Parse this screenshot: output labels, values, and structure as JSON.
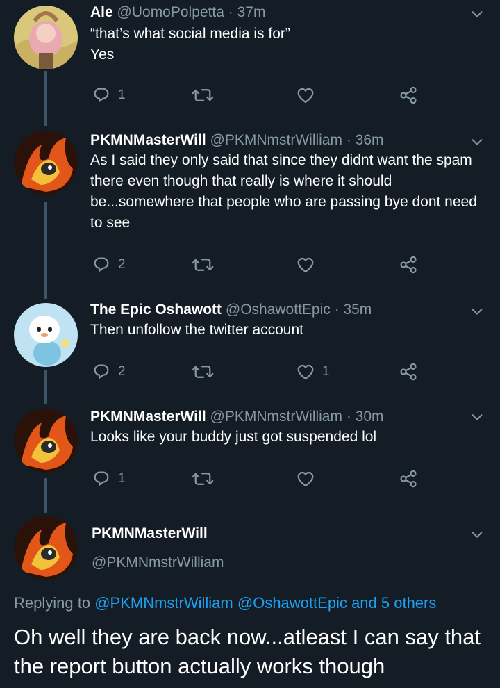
{
  "tweets": [
    {
      "name": "Ale",
      "handle": "@UomoPolpetta",
      "time": "37m",
      "lines": [
        "“that’s what social media is for”",
        "Yes"
      ],
      "reply_count": "1",
      "retweet_count": "",
      "like_count": ""
    },
    {
      "name": "PKMNMasterWill",
      "handle": "@PKMNmstrWilliam",
      "time": "36m",
      "text": "As I said they only said that since they didnt want the spam there even though that really is where it should be...somewhere that people who are passing bye dont need to see",
      "reply_count": "2",
      "retweet_count": "",
      "like_count": ""
    },
    {
      "name": "The Epic Oshawott",
      "handle": "@OshawottEpic",
      "time": "35m",
      "text": "Then unfollow the twitter account",
      "reply_count": "2",
      "retweet_count": "",
      "like_count": "1"
    },
    {
      "name": "PKMNMasterWill",
      "handle": "@PKMNmstrWilliam",
      "time": "30m",
      "text": "Looks like your buddy just got suspended lol",
      "reply_count": "1",
      "retweet_count": "",
      "like_count": ""
    }
  ],
  "focused": {
    "name": "PKMNMasterWill",
    "handle": "@PKMNmstrWilliam",
    "replying_prefix": "Replying to",
    "replying_user1": "@PKMNmstrWilliam",
    "replying_user2": "@OshawottEpic",
    "replying_others": "and 5 others",
    "text": "Oh well they are back now...atleast I can say that the report button actually works though"
  },
  "icons": {
    "reply": "reply-icon",
    "retweet": "retweet-icon",
    "like": "heart-icon",
    "share": "share-icon",
    "more": "chevron-down-icon"
  },
  "colors": {
    "background": "#141d26",
    "secondary_text": "#8899a6",
    "link": "#1da1f2",
    "thread_line": "#3d5466"
  }
}
